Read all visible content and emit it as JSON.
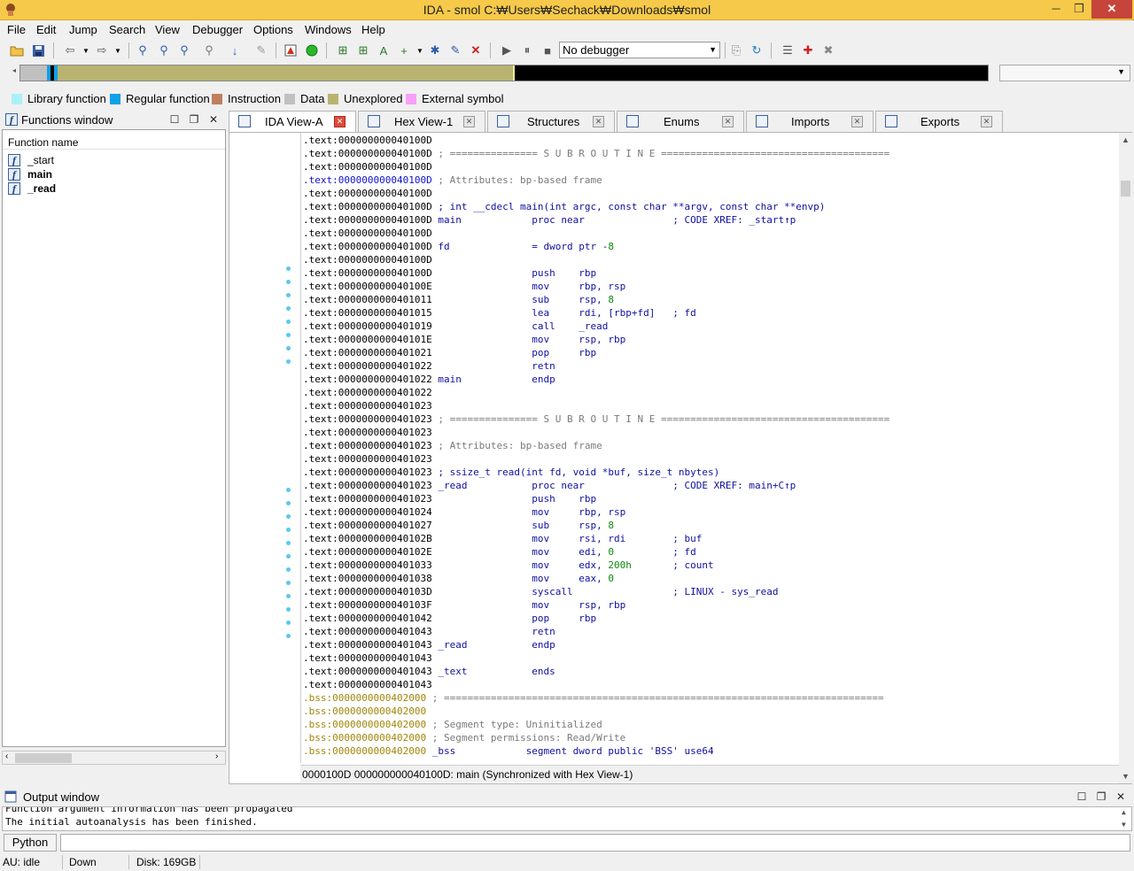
{
  "window": {
    "title": "IDA - smol C:₩Users₩Sechack₩Downloads₩smol"
  },
  "menu": [
    "File",
    "Edit",
    "Jump",
    "Search",
    "View",
    "Debugger",
    "Options",
    "Windows",
    "Help"
  ],
  "toolbar": {
    "debugger_select": "No debugger"
  },
  "legend": [
    {
      "label": "Library function",
      "color": "#aaf0f8"
    },
    {
      "label": "Regular function",
      "color": "#10a0e8"
    },
    {
      "label": "Instruction",
      "color": "#c08060"
    },
    {
      "label": "Data",
      "color": "#c0c0c0"
    },
    {
      "label": "Unexplored",
      "color": "#b8b470"
    },
    {
      "label": "External symbol",
      "color": "#f8a0f8"
    }
  ],
  "functions_window": {
    "title": "Functions window",
    "column_header": "Function name",
    "items": [
      "_start",
      "main",
      "_read"
    ]
  },
  "tabs": [
    "IDA View-A",
    "Hex View-1",
    "Structures",
    "Enums",
    "Imports",
    "Exports"
  ],
  "disasm": {
    "lines": [
      ".text:000000000040100D",
      ".text:000000000040100D ; =============== S U B R O U T I N E =======================================",
      ".text:000000000040100D",
      ".text:000000000040100D ; Attributes: bp-based frame",
      ".text:000000000040100D",
      ".text:000000000040100D ; int __cdecl main(int argc, const char **argv, const char **envp)",
      ".text:000000000040100D main            proc near               ; CODE XREF: _start↑p",
      ".text:000000000040100D",
      ".text:000000000040100D fd              = dword ptr -8",
      ".text:000000000040100D",
      ".text:000000000040100D                 push    rbp",
      ".text:000000000040100E                 mov     rbp, rsp",
      ".text:0000000000401011                 sub     rsp, 8",
      ".text:0000000000401015                 lea     rdi, [rbp+fd]   ; fd",
      ".text:0000000000401019                 call    _read",
      ".text:000000000040101E                 mov     rsp, rbp",
      ".text:0000000000401021                 pop     rbp",
      ".text:0000000000401022                 retn",
      ".text:0000000000401022 main            endp",
      ".text:0000000000401022",
      ".text:0000000000401023",
      ".text:0000000000401023 ; =============== S U B R O U T I N E =======================================",
      ".text:0000000000401023",
      ".text:0000000000401023 ; Attributes: bp-based frame",
      ".text:0000000000401023",
      ".text:0000000000401023 ; ssize_t read(int fd, void *buf, size_t nbytes)",
      ".text:0000000000401023 _read           proc near               ; CODE XREF: main+C↑p",
      ".text:0000000000401023                 push    rbp",
      ".text:0000000000401024                 mov     rbp, rsp",
      ".text:0000000000401027                 sub     rsp, 8",
      ".text:000000000040102B                 mov     rsi, rdi        ; buf",
      ".text:000000000040102E                 mov     edi, 0          ; fd",
      ".text:0000000000401033                 mov     edx, 200h       ; count",
      ".text:0000000000401038                 mov     eax, 0",
      ".text:000000000040103D                 syscall                 ; LINUX - sys_read",
      ".text:000000000040103F                 mov     rsp, rbp",
      ".text:0000000000401042                 pop     rbp",
      ".text:0000000000401043                 retn",
      ".text:0000000000401043 _read           endp",
      ".text:0000000000401043",
      ".text:0000000000401043 _text           ends",
      ".text:0000000000401043",
      ".bss:0000000000402000 ; ===========================================================================",
      ".bss:0000000000402000",
      ".bss:0000000000402000 ; Segment type: Uninitialized",
      ".bss:0000000000402000 ; Segment permissions: Read/Write",
      ".bss:0000000000402000 _bss            segment dword public 'BSS' use64"
    ],
    "status": "0000100D 000000000040100D: main (Synchronized with Hex View-1)"
  },
  "output_window": {
    "title": "Output window",
    "lines": [
      "Function argument information has been propagated",
      "The initial autoanalysis has been finished."
    ],
    "python_button": "Python"
  },
  "statusbar": {
    "au": "AU:  idle",
    "direction": "Down",
    "disk": "Disk: 169GB"
  }
}
